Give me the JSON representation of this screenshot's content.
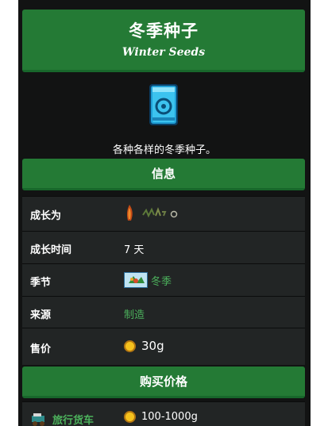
{
  "header": {
    "title_cn": "冬季种子",
    "title_en": "Winter Seeds"
  },
  "item": {
    "description": "各种各样的冬季种子。",
    "image_icon": "winter-seeds-packet-icon"
  },
  "info_section": {
    "title": "信息",
    "rows": [
      {
        "label": "成长为",
        "value": "",
        "icon": "winter-forage-icon"
      },
      {
        "label": "成长时间",
        "value": "7 天"
      },
      {
        "label": "季节",
        "value": "冬季",
        "icon": "winter-season-icon"
      },
      {
        "label": "来源",
        "value": "制造"
      },
      {
        "label": "售价",
        "value": "30g",
        "icon": "gold-coin-icon"
      }
    ]
  },
  "buy_section": {
    "title": "购买价格",
    "rows": [
      {
        "label": "旅行货车",
        "value": "100-1000g",
        "icon": "gold-coin-icon",
        "label_icon": "traveling-cart-icon"
      }
    ]
  },
  "colors": {
    "panel_green": "#247a35",
    "link_green": "#4cb15c",
    "background": "#121313",
    "row_bg": "#222525"
  }
}
